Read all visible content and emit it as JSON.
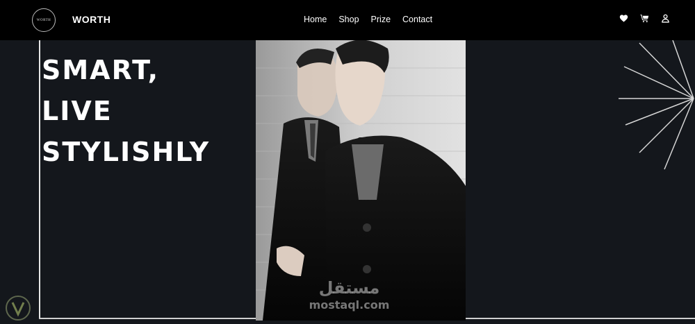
{
  "navbar": {
    "logo_text": "WORTH",
    "brand": "WORTH",
    "links": [
      "Home",
      "Shop",
      "Prize",
      "Contact"
    ],
    "icons": [
      "heart-icon",
      "cart-icon",
      "user-icon"
    ]
  },
  "hero": {
    "headline_lines": [
      "SMART,",
      "LIVE",
      "STYLISHLY"
    ],
    "image_alt": "two men in dark coats"
  },
  "watermark": {
    "arabic": "مستقل",
    "latin": "mostaql.com"
  },
  "colors": {
    "background": "#14171c",
    "navbar": "#000000",
    "text": "#ffffff",
    "accent_lines": "#e6e6e6"
  }
}
